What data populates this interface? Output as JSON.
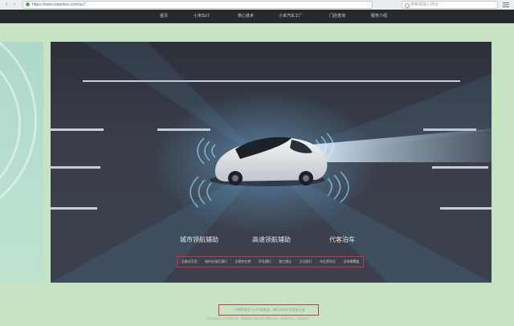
{
  "browser": {
    "url": "https://www.xiaomiev.com/su7",
    "search_placeholder": "搜索或输入网址",
    "back_glyph": "‹",
    "forward_glyph": "›"
  },
  "nav": {
    "items": [
      {
        "label": "首页"
      },
      {
        "label": "小米SU7"
      },
      {
        "label": "核心技术"
      },
      {
        "label": "小米汽车工厂"
      },
      {
        "label": "门店查询"
      },
      {
        "label": "服务介绍"
      }
    ]
  },
  "hero": {
    "features": [
      {
        "title": "城市领航辅助"
      },
      {
        "title": "高速领航辅助"
      },
      {
        "title": "代客泊车"
      }
    ],
    "feature_items": [
      "全路况可用",
      "城市红绿灯通行",
      "无保护左转",
      "环岛通行",
      "施工避让",
      "主动绕行",
      "车位到车位",
      "全场景覆盖"
    ],
    "colors": {
      "accent": "#d83030",
      "sensor": "#8fc9ee"
    }
  },
  "note": {
    "text": "* 功能将通过OTA升级推送，请以实际交付版本为准",
    "footnote": "* 实际功能以交付车辆为准，驾驶辅助功能不能代替驾驶员，请保持专注，谨慎驾驶"
  }
}
